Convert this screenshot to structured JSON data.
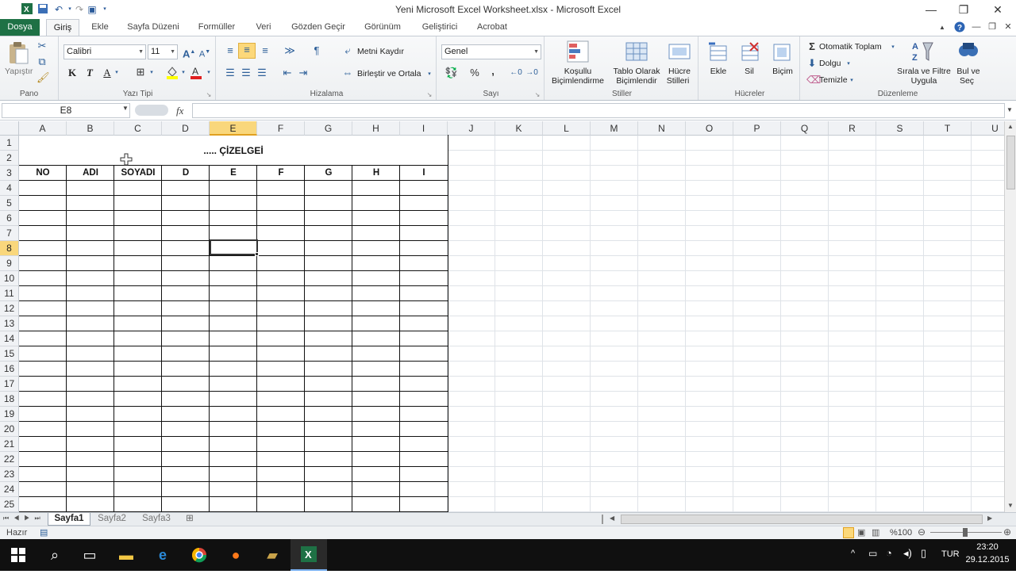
{
  "window": {
    "title": "Yeni Microsoft Excel Worksheet.xlsx - Microsoft Excel"
  },
  "tabs": {
    "file": "Dosya",
    "home": "Giriş",
    "insert": "Ekle",
    "page_layout": "Sayfa Düzeni",
    "formulas": "Formüller",
    "data": "Veri",
    "review": "Gözden Geçir",
    "view": "Görünüm",
    "developer": "Geliştirici",
    "acrobat": "Acrobat"
  },
  "ribbon": {
    "clipboard": {
      "paste": "Yapıştır",
      "label": "Pano"
    },
    "font": {
      "name": "Calibri",
      "size": "11",
      "label": "Yazı Tipi",
      "bold": "K",
      "italic": "T",
      "underline": "A"
    },
    "alignment": {
      "wrap": "Metni Kaydır",
      "merge": "Birleştir ve Ortala",
      "label": "Hizalama"
    },
    "number": {
      "format": "Genel",
      "percent": "%",
      "comma": ",",
      "label": "Sayı"
    },
    "styles": {
      "conditional_1": "Koşullu",
      "conditional_2": "Biçimlendirme",
      "table_1": "Tablo Olarak",
      "table_2": "Biçimlendir",
      "cell_1": "Hücre",
      "cell_2": "Stilleri",
      "label": "Stiller"
    },
    "cells": {
      "insert": "Ekle",
      "delete": "Sil",
      "format": "Biçim",
      "label": "Hücreler"
    },
    "editing": {
      "autosum": "Otomatik Toplam",
      "fill": "Dolgu",
      "clear": "Temizle",
      "sort_1": "Sırala ve Filtre",
      "sort_2": "Uygula",
      "find_1": "Bul ve",
      "find_2": "Seç",
      "label": "Düzenleme"
    }
  },
  "formula_bar": {
    "name_box": "E8",
    "fx": "fx",
    "value": ""
  },
  "grid": {
    "columns": [
      "A",
      "B",
      "C",
      "D",
      "E",
      "F",
      "G",
      "H",
      "I",
      "J",
      "K",
      "L",
      "M",
      "N",
      "O",
      "P",
      "Q",
      "R",
      "S",
      "T",
      "U"
    ],
    "rows": [
      "1",
      "2",
      "3",
      "4",
      "5",
      "6",
      "7",
      "8",
      "9",
      "10",
      "11",
      "12",
      "13",
      "14",
      "15",
      "16",
      "17",
      "18",
      "19",
      "20",
      "21",
      "22",
      "23",
      "24",
      "25"
    ],
    "selected_cell": "E8",
    "title_cell": "..... ÇİZELGEİ",
    "headers": [
      "NO",
      "ADI",
      "SOYADI",
      "D",
      "E",
      "F",
      "G",
      "H",
      "I"
    ]
  },
  "sheets": {
    "tabs": [
      "Sayfa1",
      "Sayfa2",
      "Sayfa3"
    ],
    "active": "Sayfa1"
  },
  "status": {
    "ready": "Hazır",
    "zoom": "%100"
  },
  "taskbar": {
    "language": "TUR",
    "time": "23:20",
    "date": "29.12.2015"
  }
}
